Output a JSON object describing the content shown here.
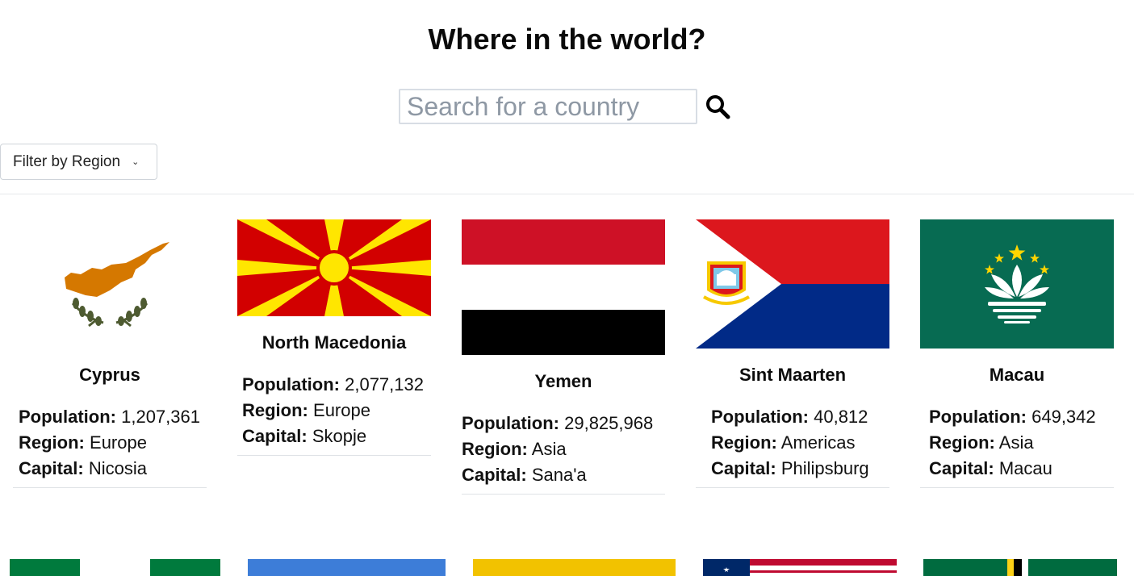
{
  "page": {
    "title": "Where in the world?",
    "search": {
      "placeholder": "Search for a country",
      "value": ""
    },
    "search_icon": "magnifier-icon",
    "filter": {
      "label": "Filter by Region",
      "icon": "chevron-down-icon"
    }
  },
  "labels": {
    "population": "Population:",
    "region": "Region:",
    "capital": "Capital:"
  },
  "countries": [
    {
      "name": "Cyprus",
      "population": "1,207,361",
      "region": "Europe",
      "capital": "Nicosia"
    },
    {
      "name": "North Macedonia",
      "population": "2,077,132",
      "region": "Europe",
      "capital": "Skopje"
    },
    {
      "name": "Yemen",
      "population": "29,825,968",
      "region": "Asia",
      "capital": "Sana'a"
    },
    {
      "name": "Sint Maarten",
      "population": "40,812",
      "region": "Americas",
      "capital": "Philipsburg"
    },
    {
      "name": "Macau",
      "population": "649,342",
      "region": "Asia",
      "capital": "Macau"
    }
  ],
  "colors": {
    "accent_text": "#111111",
    "border": "#d8dde4",
    "divider": "#e6e8eb"
  }
}
